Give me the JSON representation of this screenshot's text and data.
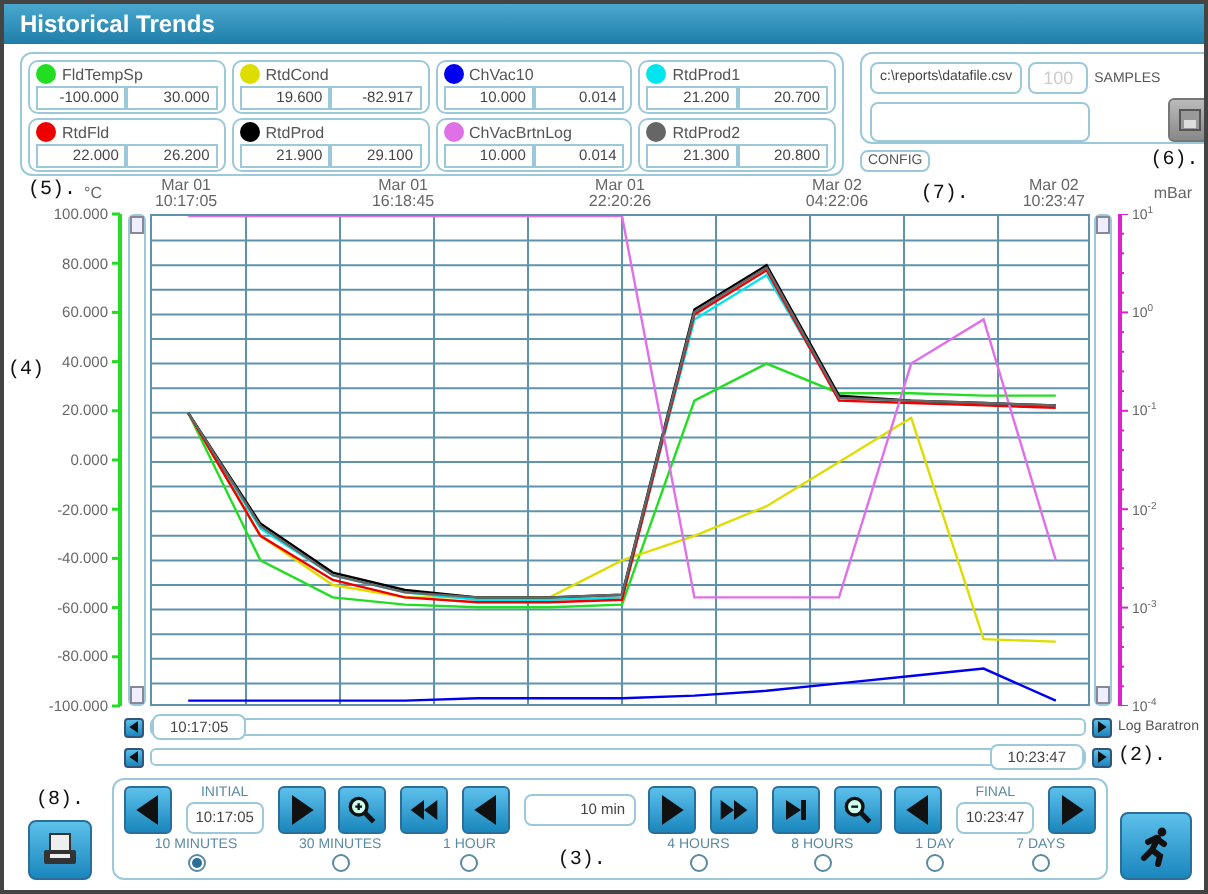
{
  "window": {
    "title": "Historical Trends"
  },
  "legend": [
    {
      "min": "-100.000",
      "max": "30.000"
    },
    {
      "min": "19.600",
      "max": "-82.917"
    },
    {
      "min": "10.000",
      "max": "0.014"
    },
    {
      "min": "21.200",
      "max": "20.700"
    },
    {
      "min": "22.000",
      "max": "26.200"
    },
    {
      "min": "21.900",
      "max": "29.100"
    },
    {
      "min": "10.000",
      "max": "0.014"
    },
    {
      "min": "21.300",
      "max": "20.800"
    }
  ],
  "export": {
    "file_path": "c:\\reports\\datafile.csv",
    "samples_placeholder": "100",
    "samples_label": "SAMPLES",
    "config_button": "CONFIG"
  },
  "callouts": [
    "(5).",
    "(4)",
    "(7).",
    "(6).",
    "(2).",
    "(8).",
    "(3)."
  ],
  "chart": {
    "left_unit": "°C",
    "right_unit": "mBar",
    "right_ticks": [
      "10$^{1}$",
      "10$^{0}$",
      "10$^{-1}$",
      "10$^{-2}$",
      "10$^{-3}$",
      "10$^{-4}$"
    ],
    "right_axis_name": "Log Baratron",
    "chart_data": {
      "type": "line",
      "grid": true,
      "categories": [
        "Mar 01 10:17:05",
        null,
        null,
        "Mar 01 16:18:45",
        null,
        null,
        "Mar 01 22:20:26",
        null,
        null,
        "Mar 02 04:22:06",
        null,
        null,
        "Mar 02 10:23:47"
      ],
      "ylim": [
        -100,
        100
      ],
      "yticks": [
        {
          "value": 100,
          "label": "100.000"
        },
        {
          "value": 80,
          "label": "80.000"
        },
        {
          "value": 60,
          "label": "60.000"
        },
        {
          "value": 40,
          "label": "40.000"
        },
        {
          "value": 20,
          "label": "20.000"
        },
        {
          "value": 0,
          "label": "0.000"
        },
        {
          "value": -20,
          "label": "-20.000"
        },
        {
          "value": -40,
          "label": "-40.000"
        },
        {
          "value": -60,
          "label": "-60.000"
        },
        {
          "value": -80,
          "label": "-80.000"
        },
        {
          "value": -100,
          "label": "-100.000"
        }
      ],
      "series": [
        {
          "name": "FldTempSp",
          "color": "#22dd22",
          "values": [
            20,
            -40,
            -55,
            -58,
            -59,
            -59,
            -58,
            25,
            40,
            28,
            28,
            27,
            27
          ]
        },
        {
          "name": "RtdCond",
          "color": "#dddd00",
          "values": [
            20,
            -30,
            -50,
            -55,
            -55,
            -55,
            -40,
            -30,
            -18,
            0,
            18,
            -72,
            -73
          ]
        },
        {
          "name": "ChVac10",
          "color": "#0000ee",
          "values": [
            -97,
            -97,
            -97,
            -97,
            -96,
            -96,
            -96,
            -95,
            -93,
            -90,
            -87,
            -84,
            -97
          ]
        },
        {
          "name": "RtdProd1",
          "color": "#00e5ee",
          "values": [
            20,
            -27,
            -46,
            -53,
            -56,
            -56,
            -55,
            58,
            76,
            26,
            25,
            null,
            null
          ]
        },
        {
          "name": "RtdFld",
          "color": "#ee0000",
          "values": [
            20,
            -30,
            -48,
            -55,
            -57,
            -57,
            -56,
            60,
            78,
            25,
            24,
            23,
            22
          ]
        },
        {
          "name": "RtdProd",
          "color": "#000000",
          "values": [
            20,
            -25,
            -45,
            -52,
            -55,
            -55,
            -54,
            62,
            80,
            27,
            25,
            24,
            23
          ]
        },
        {
          "name": "ChVacBrtnLog",
          "color": "#e070e8",
          "values": [
            100,
            100,
            100,
            100,
            100,
            100,
            100,
            -55,
            -55,
            -55,
            40,
            58,
            -40
          ]
        },
        {
          "name": "RtdProd2",
          "color": "#666666",
          "values": [
            20,
            -26,
            -46,
            -53,
            -55,
            -55,
            -54,
            61,
            79,
            26,
            25,
            24,
            23
          ]
        }
      ]
    }
  },
  "scroll": {
    "start_time": "10:17:05",
    "end_time": "10:23:47"
  },
  "controls": {
    "initial_label": "INITIAL",
    "initial_time": "10:17:05",
    "span": "10 min",
    "final_label": "FINAL",
    "final_time": "10:23:47",
    "ranges": [
      {
        "label": "10 MINUTES",
        "selected": true
      },
      {
        "label": "30 MINUTES",
        "selected": false
      },
      {
        "label": "1 HOUR",
        "selected": false
      },
      {
        "label": "4 HOURS",
        "selected": false
      },
      {
        "label": "8 HOURS",
        "selected": false
      },
      {
        "label": "1 DAY",
        "selected": false
      },
      {
        "label": "7 DAYS",
        "selected": false
      }
    ]
  }
}
